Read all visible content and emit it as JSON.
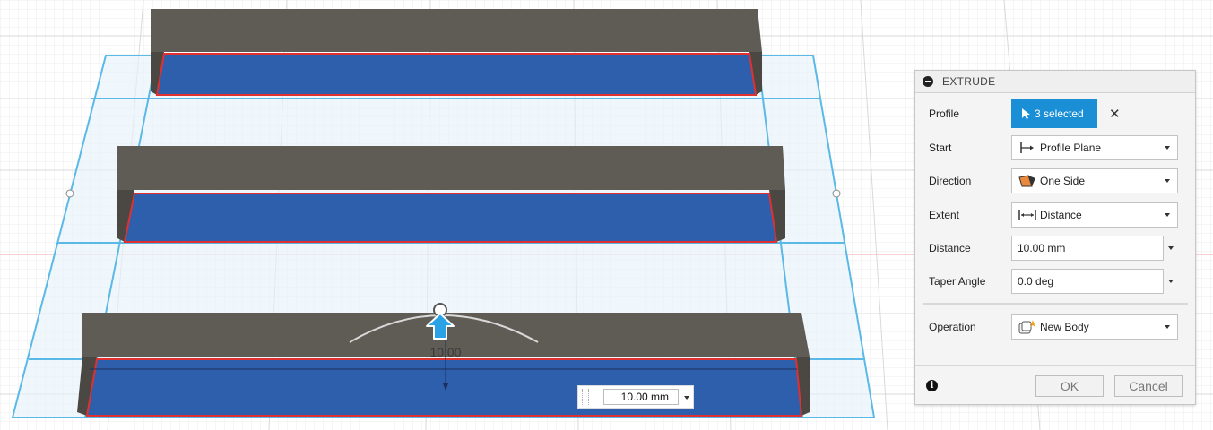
{
  "dialog": {
    "title": "EXTRUDE",
    "profile": {
      "label": "Profile",
      "selection": "3 selected",
      "clear_icon": "close-icon"
    },
    "start": {
      "label": "Start",
      "value": "Profile Plane",
      "icon": "profile-plane-icon"
    },
    "direction": {
      "label": "Direction",
      "value": "One Side",
      "icon": "one-side-icon"
    },
    "extent": {
      "label": "Extent",
      "value": "Distance",
      "icon": "distance-icon"
    },
    "distance": {
      "label": "Distance",
      "value": "10.00 mm"
    },
    "taper_angle": {
      "label": "Taper Angle",
      "value": "0.0 deg"
    },
    "operation": {
      "label": "Operation",
      "value": "New Body",
      "icon": "new-body-icon"
    },
    "ok_label": "OK",
    "cancel_label": "Cancel"
  },
  "viewport": {
    "distance_input": "10.00 mm",
    "manipulator_label": "10.00"
  },
  "colors": {
    "selection_accent": "#1b8fd6",
    "profile_face": "#2e5fad",
    "body_gray": "#5f5b55",
    "sketch_plane": "#5ab9e6",
    "profile_edge": "#e03030"
  }
}
